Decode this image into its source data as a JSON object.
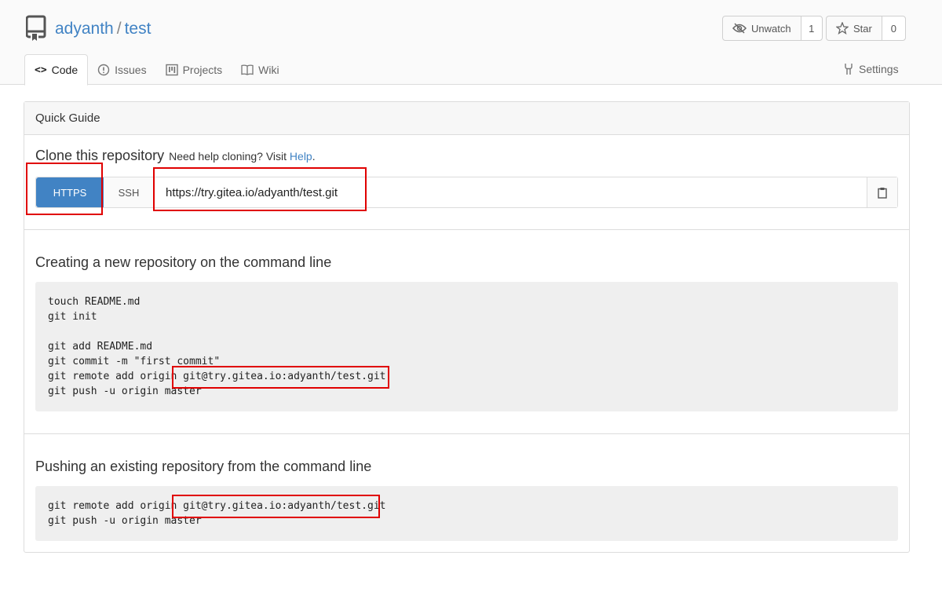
{
  "repo": {
    "owner": "adyanth",
    "separator": "/",
    "name": "test"
  },
  "actions": {
    "watch": {
      "label": "Unwatch",
      "count": "1"
    },
    "star": {
      "label": "Star",
      "count": "0"
    }
  },
  "tabs": [
    {
      "label": "Code"
    },
    {
      "label": "Issues"
    },
    {
      "label": "Projects"
    },
    {
      "label": "Wiki"
    }
  ],
  "settings_label": "Settings",
  "panel": {
    "header": "Quick Guide",
    "clone": {
      "title": "Clone this repository",
      "help_text": "Need help cloning? Visit",
      "help_link": "Help",
      "help_period": ".",
      "https_label": "HTTPS",
      "ssh_label": "SSH",
      "url": "https://try.gitea.io/adyanth/test.git"
    },
    "new_repo": {
      "title": "Creating a new repository on the command line",
      "code": "touch README.md\ngit init\n\ngit add README.md\ngit commit -m \"first commit\"\ngit remote add origin git@try.gitea.io:adyanth/test.git\ngit push -u origin master"
    },
    "existing_repo": {
      "title": "Pushing an existing repository from the command line",
      "code": "git remote add origin git@try.gitea.io:adyanth/test.git\ngit push -u origin master"
    }
  },
  "colors": {
    "accent": "#4183c4",
    "highlight": "#e00000"
  }
}
